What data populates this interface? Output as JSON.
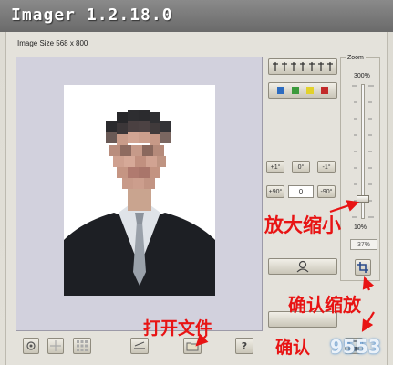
{
  "window": {
    "title": "Imager 1.2.18.0"
  },
  "image": {
    "size_label": "Image Size 568 x 800"
  },
  "zoom": {
    "label": "Zoom",
    "max_label": "300%",
    "min_label": "10%",
    "value_label": "37%"
  },
  "rotate": {
    "plus1": "+1°",
    "zero": "0°",
    "minus1": "-1°",
    "plus90": "+90°",
    "value": "0",
    "minus90": "-90°"
  },
  "annotations": {
    "zoom": "放大缩小",
    "confirm_zoom": "确认缩放",
    "open_file": "打开文件",
    "confirm": "确认"
  },
  "watermark": "9553",
  "colors": {
    "annotation": "#e81414",
    "swatches": [
      "#2d6cc0",
      "#3c9a3c",
      "#e2d12b",
      "#c22a2a"
    ]
  },
  "icons": {
    "align": "align-top-icon",
    "crop": "crop-icon",
    "face": "face-detect-icon",
    "open": "folder-icon",
    "help": "help-icon",
    "save": "save-icon"
  }
}
